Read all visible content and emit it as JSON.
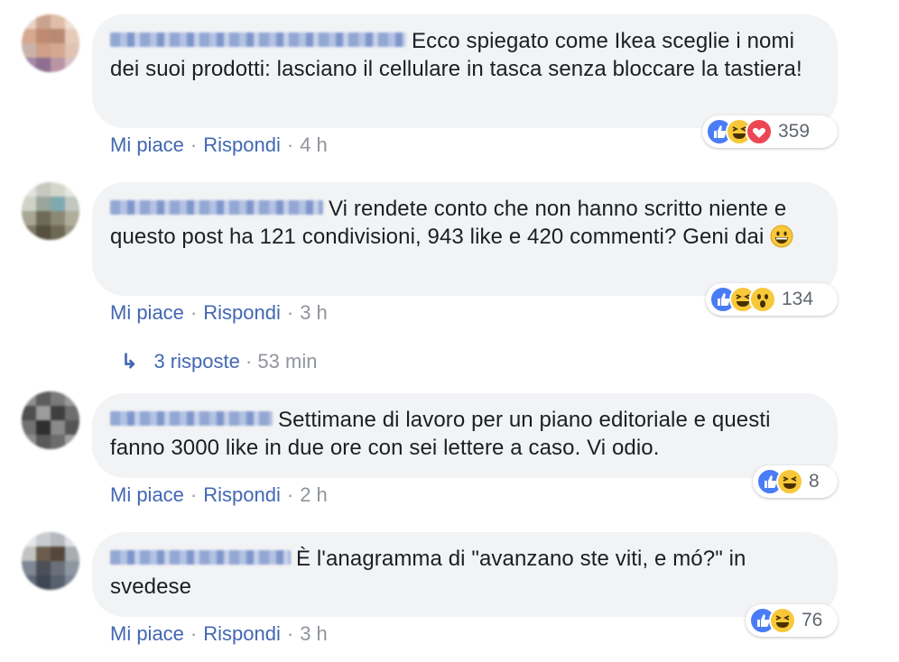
{
  "colors": {
    "link": "#4267b2",
    "meta": "#90949c",
    "bubble": "#f2f3f5",
    "like": "#4a7cf6",
    "haha": "#f7c83a",
    "love": "#ed4653"
  },
  "action_labels": {
    "like": "Mi piace",
    "reply": "Rispondi",
    "separator": "·"
  },
  "comments": [
    {
      "text": "Ecco spiegato come Ikea sceglie i nomi dei suoi prodotti: lasciano il cellulare in tasca senza bloccare la tastiera!",
      "time": "4 h",
      "reactions": [
        "like-icon",
        "haha-icon",
        "love-icon"
      ],
      "reaction_count": "359"
    },
    {
      "text": "Vi rendete conto che non hanno scritto niente e questo post ha 121 condivisioni, 943 like e 420 commenti? Geni dai",
      "inline_emoji": "grinning-emoji",
      "time": "3 h",
      "reactions": [
        "like-icon",
        "haha-icon",
        "wow-icon"
      ],
      "reaction_count": "134"
    },
    {
      "text": "Settimane di lavoro per un piano editoriale e questi fanno 3000 like in due ore con sei lettere a caso. Vi odio.",
      "time": "2 h",
      "reactions": [
        "like-icon",
        "haha-icon"
      ],
      "reaction_count": "8"
    },
    {
      "text": "È l'anagramma di \"avanzano ste viti, e mó?\" in svedese",
      "time": "3 h",
      "reactions": [
        "like-icon",
        "haha-icon"
      ],
      "reaction_count": "76"
    }
  ],
  "replies_link": {
    "icon": "reply-arrow-icon",
    "label": "3 risposte",
    "separator": "·",
    "time": "53 min"
  }
}
